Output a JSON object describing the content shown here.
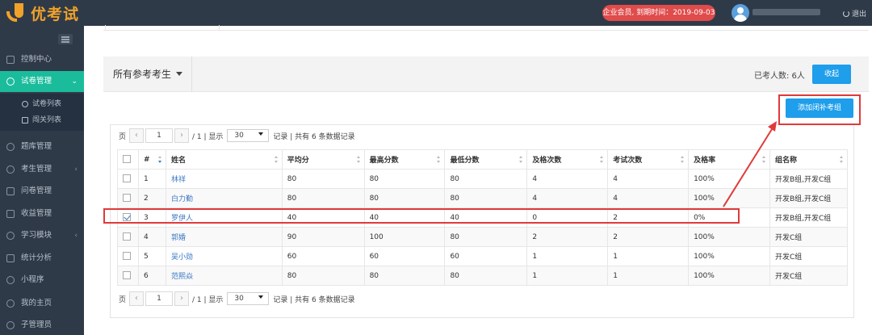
{
  "app": {
    "logo_text": "优考试",
    "vip_badge": "企业会员, 到期时间：2019-09-03",
    "logout_label": "退出"
  },
  "sidebar": {
    "items": [
      {
        "label": "控制中心",
        "icon": "home-icon"
      },
      {
        "label": "试卷管理",
        "icon": "check-circle-icon",
        "active": true
      },
      {
        "label": "题库管理",
        "icon": "question-icon"
      },
      {
        "label": "考生管理",
        "icon": "user-icon"
      },
      {
        "label": "问卷管理",
        "icon": "survey-icon"
      },
      {
        "label": "收益管理",
        "icon": "wallet-icon"
      },
      {
        "label": "学习模块",
        "icon": "graduation-icon"
      },
      {
        "label": "统计分析",
        "icon": "chart-icon"
      },
      {
        "label": "小程序",
        "icon": "wechat-icon"
      },
      {
        "label": "我的主页",
        "icon": "person-icon"
      },
      {
        "label": "子管理员",
        "icon": "admin-icon"
      }
    ],
    "subitems": [
      {
        "label": "试卷列表",
        "icon": "check-circle-icon"
      },
      {
        "label": "闯关列表",
        "icon": "shuffle-icon"
      }
    ]
  },
  "header": {
    "filter_label": "所有参考考生",
    "examined_text": "已考人数: 6人",
    "collapse_label": "收起"
  },
  "add_group_label": "添加闭补考组",
  "pager": {
    "prefix": "页",
    "prev": "‹",
    "current_page": "1",
    "next": "›",
    "total_pages": "/ 1 | 显示",
    "page_size": "30",
    "summary": "记录 | 共有 6 条数据记录"
  },
  "table": {
    "columns": [
      "#",
      "姓名",
      "平均分",
      "最高分数",
      "最低分数",
      "及格次数",
      "考试次数",
      "及格率",
      "组名称"
    ],
    "rows": [
      {
        "checked": false,
        "num": "1",
        "name": "林祥",
        "avg": "80",
        "max": "80",
        "min": "80",
        "pass": "4",
        "times": "4",
        "rate": "100%",
        "group": "开发B组,开发C组"
      },
      {
        "checked": false,
        "num": "2",
        "name": "白力勤",
        "avg": "80",
        "max": "80",
        "min": "80",
        "pass": "4",
        "times": "4",
        "rate": "100%",
        "group": "开发B组,开发C组"
      },
      {
        "checked": true,
        "num": "3",
        "name": "罗伊人",
        "avg": "40",
        "max": "40",
        "min": "40",
        "pass": "0",
        "times": "2",
        "rate": "0%",
        "group": "开发B组,开发C组"
      },
      {
        "checked": false,
        "num": "4",
        "name": "郭婚",
        "avg": "90",
        "max": "100",
        "min": "80",
        "pass": "2",
        "times": "2",
        "rate": "100%",
        "group": "开发C组"
      },
      {
        "checked": false,
        "num": "5",
        "name": "吴小勋",
        "avg": "60",
        "max": "60",
        "min": "60",
        "pass": "1",
        "times": "1",
        "rate": "100%",
        "group": "开发C组"
      },
      {
        "checked": false,
        "num": "6",
        "name": "范熙焱",
        "avg": "80",
        "max": "80",
        "min": "80",
        "pass": "1",
        "times": "1",
        "rate": "100%",
        "group": "开发C组"
      }
    ]
  },
  "colors": {
    "sidebar_bg": "#2f3a48",
    "active": "#1abc9c",
    "primary": "#1e9eeb",
    "highlight": "#e03a3a",
    "link": "#3a78c3"
  }
}
